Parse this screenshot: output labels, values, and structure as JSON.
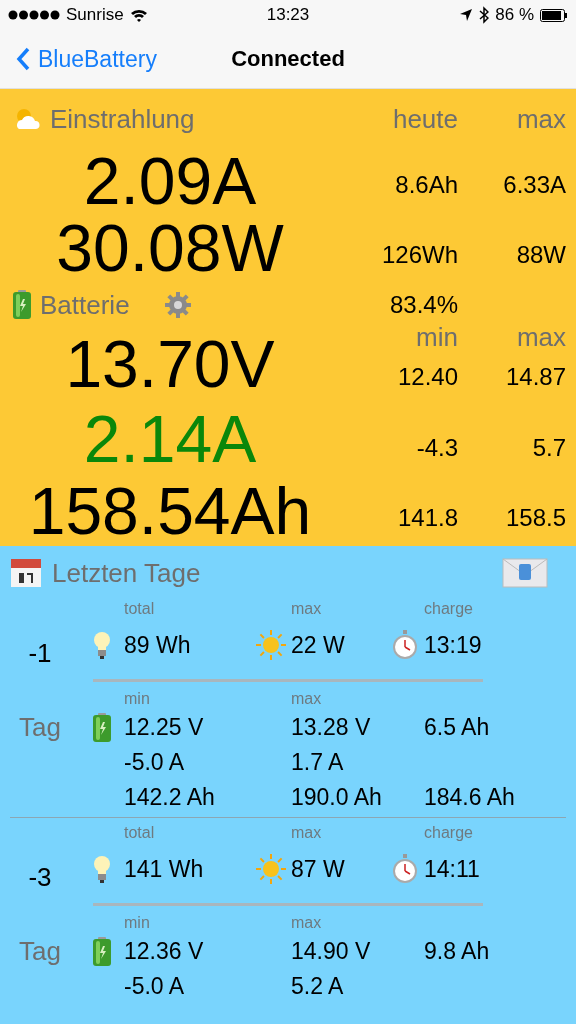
{
  "status_bar": {
    "carrier": "Sunrise",
    "time": "13:23",
    "battery": "86 %"
  },
  "nav": {
    "back": "BlueBattery",
    "title": "Connected"
  },
  "irradiance": {
    "title": "Einstrahlung",
    "columns": [
      "heute",
      "max"
    ],
    "rows": [
      {
        "value": "2.09A",
        "today": "8.6Ah",
        "max": "6.33A"
      },
      {
        "value": "30.08W",
        "today": "126Wh",
        "max": "88W"
      }
    ]
  },
  "battery": {
    "title": "Batterie",
    "charge": "83.4%",
    "columns": [
      "min",
      "max"
    ],
    "rows": [
      {
        "value": "13.70V",
        "min": "12.40",
        "max": "14.87",
        "color": "#000000"
      },
      {
        "value": "2.14A",
        "min": "-4.3",
        "max": "5.7",
        "color": "#0a870a"
      },
      {
        "value": "158.54Ah",
        "min": "141.8",
        "max": "158.5",
        "color": "#000000"
      }
    ]
  },
  "recent_days": {
    "title": "Letzten Tage",
    "days": [
      {
        "day": "-1",
        "summary_labels": [
          "total",
          "max",
          "charge"
        ],
        "summary_values": [
          "89 Wh",
          "22 W",
          "13:19"
        ],
        "battery_label": "Tag",
        "battery_columns": [
          "min",
          "max"
        ],
        "battery_rows": [
          [
            "12.25 V",
            "13.28 V",
            "6.5 Ah"
          ],
          [
            "-5.0 A",
            "1.7 A"
          ],
          [
            "142.2 Ah",
            "190.0 Ah",
            "184.6 Ah"
          ]
        ]
      },
      {
        "day": "-3",
        "summary_labels": [
          "total",
          "max",
          "charge"
        ],
        "summary_values": [
          "141 Wh",
          "87 W",
          "14:11"
        ],
        "battery_label": "Tag",
        "battery_columns": [
          "min",
          "max"
        ],
        "battery_rows": [
          [
            "12.36 V",
            "14.90 V",
            "9.8 Ah"
          ],
          [
            "-5.0 A",
            "5.2 A"
          ]
        ]
      }
    ]
  }
}
